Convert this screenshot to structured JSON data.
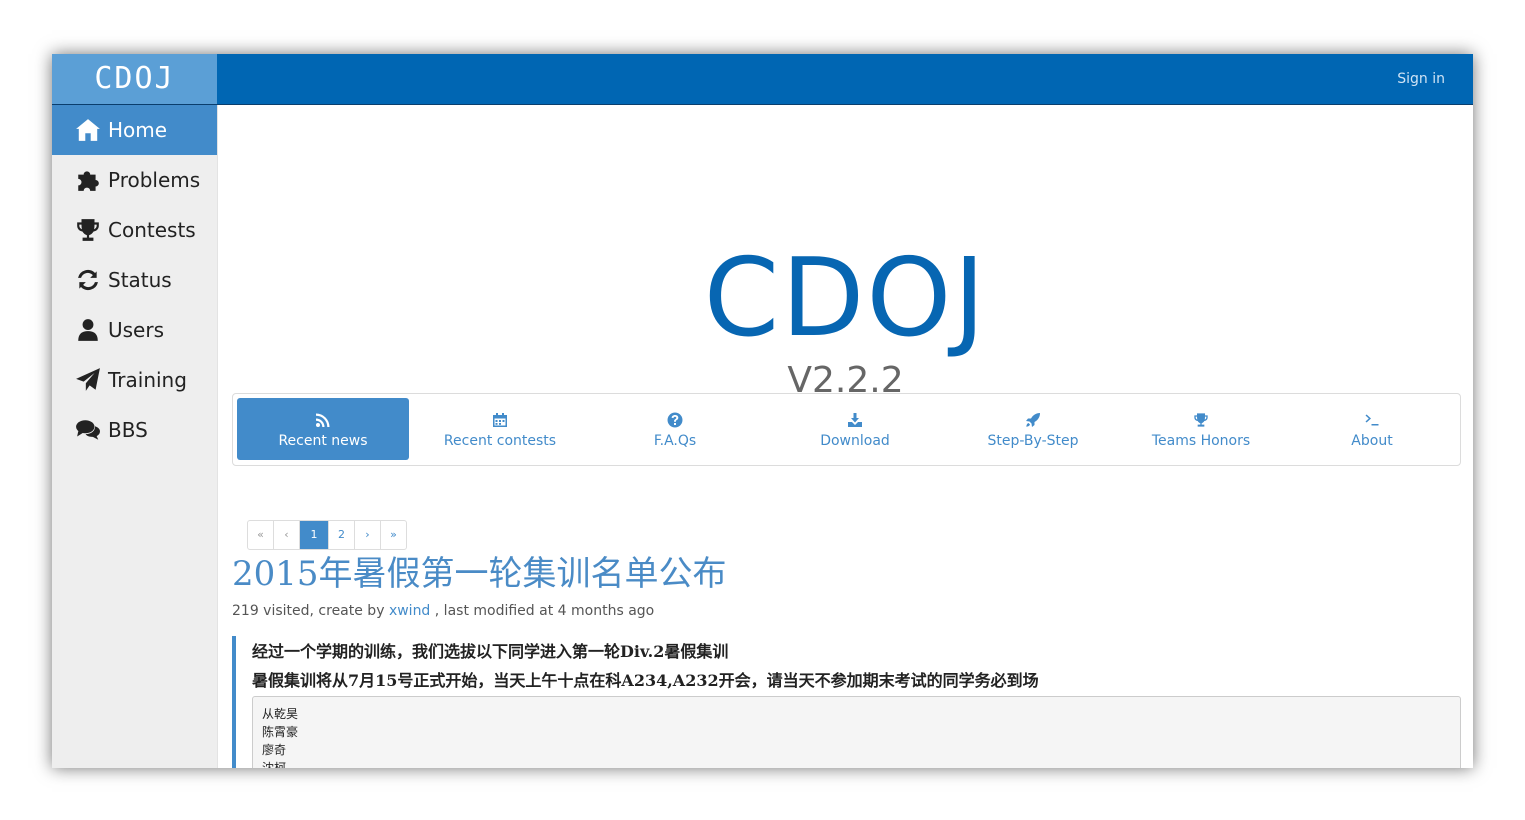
{
  "brand": "CDOJ",
  "topbar": {
    "signin_label": "Sign in"
  },
  "sidebar": {
    "items": [
      {
        "label": "Home",
        "icon": "home-icon",
        "active": true
      },
      {
        "label": "Problems",
        "icon": "puzzle-icon"
      },
      {
        "label": "Contests",
        "icon": "trophy-icon"
      },
      {
        "label": "Status",
        "icon": "refresh-icon"
      },
      {
        "label": "Users",
        "icon": "user-icon"
      },
      {
        "label": "Training",
        "icon": "paper-plane-icon"
      },
      {
        "label": "BBS",
        "icon": "comments-icon"
      }
    ]
  },
  "hero": {
    "title": "CDOJ",
    "version": "V2.2.2"
  },
  "tabs": [
    {
      "label": "Recent news",
      "icon": "rss-icon",
      "active": true
    },
    {
      "label": "Recent contests",
      "icon": "calendar-icon"
    },
    {
      "label": "F.A.Qs",
      "icon": "question-circle-icon"
    },
    {
      "label": "Download",
      "icon": "download-icon"
    },
    {
      "label": "Step-By-Step",
      "icon": "rocket-icon"
    },
    {
      "label": "Teams Honors",
      "icon": "trophy-icon"
    },
    {
      "label": "About",
      "icon": "terminal-icon"
    }
  ],
  "pagination": {
    "first": "«",
    "prev": "‹",
    "pages": [
      "1",
      "2"
    ],
    "current": "1",
    "next": "›",
    "last": "»"
  },
  "post": {
    "title": "2015年暑假第一轮集训名单公布",
    "meta_prefix": "219 visited, create by",
    "author": "xwind",
    "meta_suffix": ", last modified at 4 months ago",
    "lines": [
      "经过一个学期的训练，我们选拔以下同学进入第一轮Div.2暑假集训",
      "暑假集训将从7月15号正式开始，当天上午十点在科A234,A232开会，请当天不参加期末考试的同学务必到场"
    ],
    "names": [
      "从乾昊",
      "陈霄豪",
      "廖奇",
      "沈柯"
    ]
  },
  "colors": {
    "primary": "#428bca",
    "topbar": "#0066b3",
    "brand_bg": "#5b9fd6",
    "hero": "#0766b2"
  }
}
